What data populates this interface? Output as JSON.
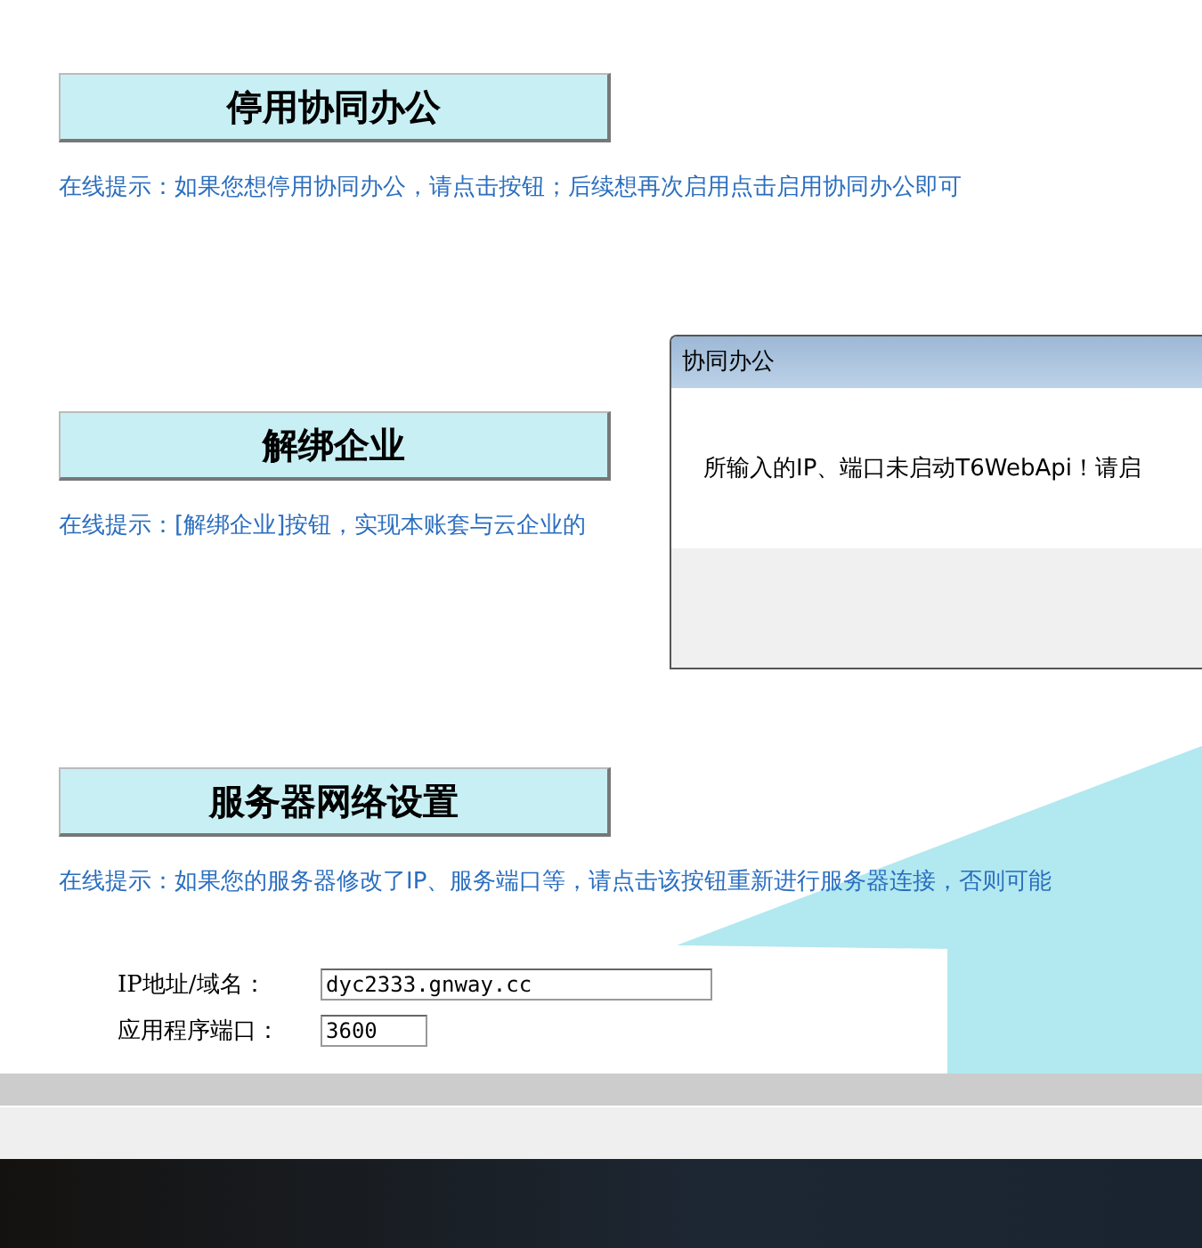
{
  "sections": [
    {
      "button": "停用协同办公",
      "hint": "在线提示：如果您想停用协同办公，请点击按钮；后续想再次启用点击启用协同办公即可"
    },
    {
      "button": "解绑企业",
      "hint": "在线提示：[解绑企业]按钮，实现本账套与云企业的"
    },
    {
      "button": "服务器网络设置",
      "hint": "在线提示：如果您的服务器修改了IP、服务端口等，请点击该按钮重新进行服务器连接，否则可能"
    }
  ],
  "form": [
    {
      "label": "IP地址/域名：",
      "value": "dyc2333.gnway.cc"
    },
    {
      "label": "应用程序端口：",
      "value": "3600"
    }
  ],
  "dialog": {
    "title": "协同办公",
    "message": "所输入的IP、端口未启动T6WebApi！请启"
  }
}
